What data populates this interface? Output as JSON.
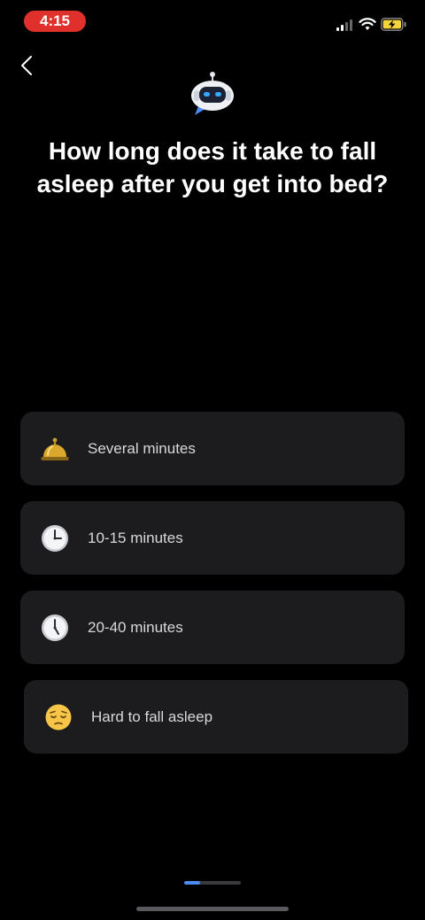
{
  "status_bar": {
    "time": "4:15",
    "time_pill_color": "#e0302b",
    "signal_icon": "cellular-signal-icon",
    "wifi_icon": "wifi-icon",
    "battery_icon": "battery-charging-icon"
  },
  "header": {
    "back_icon": "chevron-left-icon",
    "mascot_icon": "robot-chat-icon"
  },
  "question": {
    "text": "How long does it take to fall asleep after you get into bed?"
  },
  "options": [
    {
      "label": "Several minutes",
      "icon": "bellhop-bell-icon"
    },
    {
      "label": "10-15 minutes",
      "icon": "clock-three-icon"
    },
    {
      "label": "20-40 minutes",
      "icon": "clock-five-icon"
    },
    {
      "label": "Hard to fall asleep",
      "icon": "pensive-face-icon"
    }
  ],
  "progress": {
    "fraction": 0.28,
    "color": "#4d8bf4"
  }
}
